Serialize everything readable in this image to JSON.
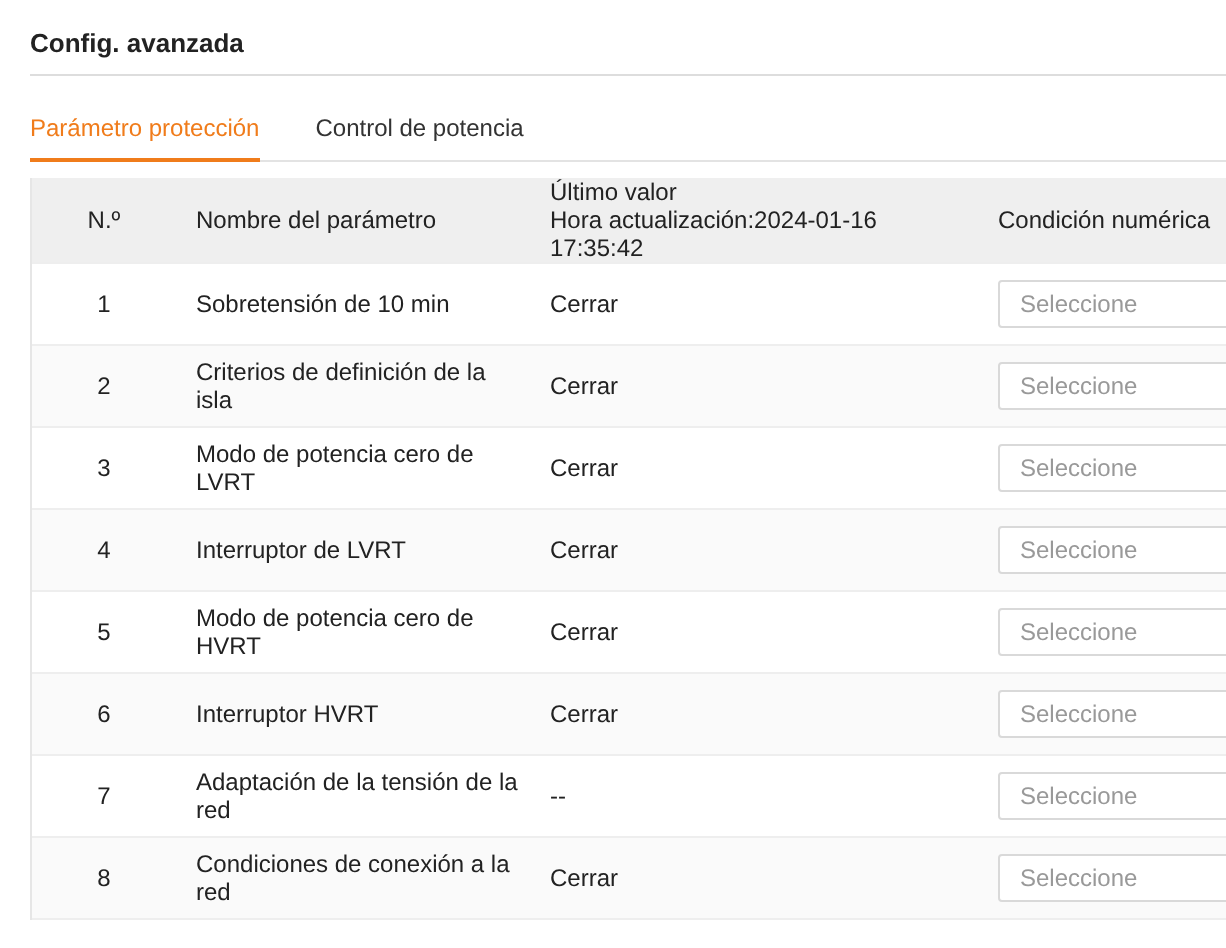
{
  "page": {
    "title": "Config. avanzada"
  },
  "tabs": [
    {
      "label": "Parámetro protección",
      "selected": true
    },
    {
      "label": "Control de potencia",
      "selected": false
    }
  ],
  "table": {
    "columns": [
      "N.º",
      "Nombre del parámetro",
      "Último valor\nHora actualización:2024-01-16 17:35:42",
      "Condición numérica"
    ],
    "rows": [
      {
        "number": "1",
        "name": "Sobretensión de 10 min",
        "value": "Cerrar",
        "placeholder": "Seleccione"
      },
      {
        "number": "2",
        "name": "Criterios de definición de la isla",
        "value": "Cerrar",
        "placeholder": "Seleccione"
      },
      {
        "number": "3",
        "name": "Modo de potencia cero de LVRT",
        "value": "Cerrar",
        "placeholder": "Seleccione"
      },
      {
        "number": "4",
        "name": "Interruptor de LVRT",
        "value": "Cerrar",
        "placeholder": "Seleccione"
      },
      {
        "number": "5",
        "name": "Modo de potencia cero de HVRT",
        "value": "Cerrar",
        "placeholder": "Seleccione"
      },
      {
        "number": "6",
        "name": "Interruptor HVRT",
        "value": "Cerrar",
        "placeholder": "Seleccione"
      },
      {
        "number": "7",
        "name": "Adaptación de la tensión de la red",
        "value": "--",
        "placeholder": "Seleccione"
      },
      {
        "number": "8",
        "name": "Condiciones de conexión a la red",
        "value": "Cerrar",
        "placeholder": "Seleccione"
      }
    ]
  }
}
